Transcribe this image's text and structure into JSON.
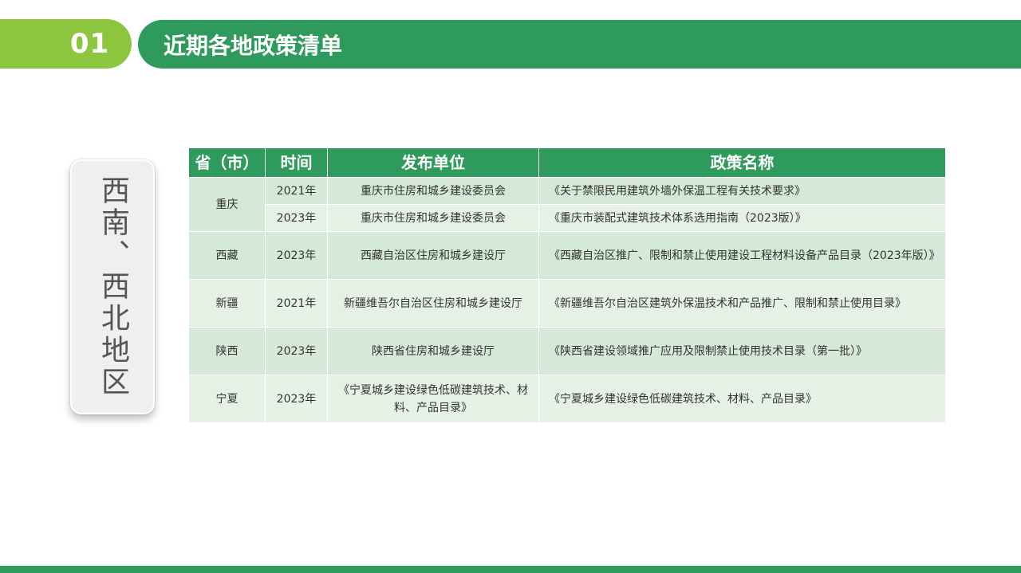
{
  "header": {
    "number": "01",
    "title": "近期各地政策清单"
  },
  "side_label": "西南、西北地区",
  "table": {
    "columns": [
      "省（市）",
      "时间",
      "发布单位",
      "政策名称"
    ],
    "rows": [
      {
        "province": "重庆",
        "entries": [
          {
            "year": "2021年",
            "issuer": "重庆市住房和城乡建设委员会",
            "policy": "《关于禁限民用建筑外墙外保温工程有关技术要求》"
          },
          {
            "year": "2023年",
            "issuer": "重庆市住房和城乡建设委员会",
            "policy": "《重庆市装配式建筑技术体系选用指南（2023版）》"
          }
        ]
      },
      {
        "province": "西藏",
        "entries": [
          {
            "year": "2023年",
            "issuer": "西藏自治区住房和城乡建设厅",
            "policy": "《西藏自治区推广、限制和禁止使用建设工程材料设备产品目录（2023年版）》"
          }
        ]
      },
      {
        "province": "新疆",
        "entries": [
          {
            "year": "2021年",
            "issuer": "新疆维吾尔自治区住房和城乡建设厅",
            "policy": "《新疆维吾尔自治区建筑外保温技术和产品推广、限制和禁止使用目录》"
          }
        ]
      },
      {
        "province": "陕西",
        "entries": [
          {
            "year": "2023年",
            "issuer": "陕西省住房和城乡建设厅",
            "policy": "《陕西省建设领域推广应用及限制禁止使用技术目录（第一批）》"
          }
        ]
      },
      {
        "province": "宁夏",
        "entries": [
          {
            "year": "2023年",
            "issuer": "《宁夏城乡建设绿色低碳建筑技术、材料、产品目录》",
            "policy": "《宁夏城乡建设绿色低碳建筑技术、材料、产品目录》"
          }
        ]
      }
    ]
  },
  "colors": {
    "accent_light_green": "#8cc63e",
    "accent_green": "#2e9b5c",
    "row_shade_a": "#d6e9d8",
    "row_shade_b": "#e6f1e5"
  }
}
